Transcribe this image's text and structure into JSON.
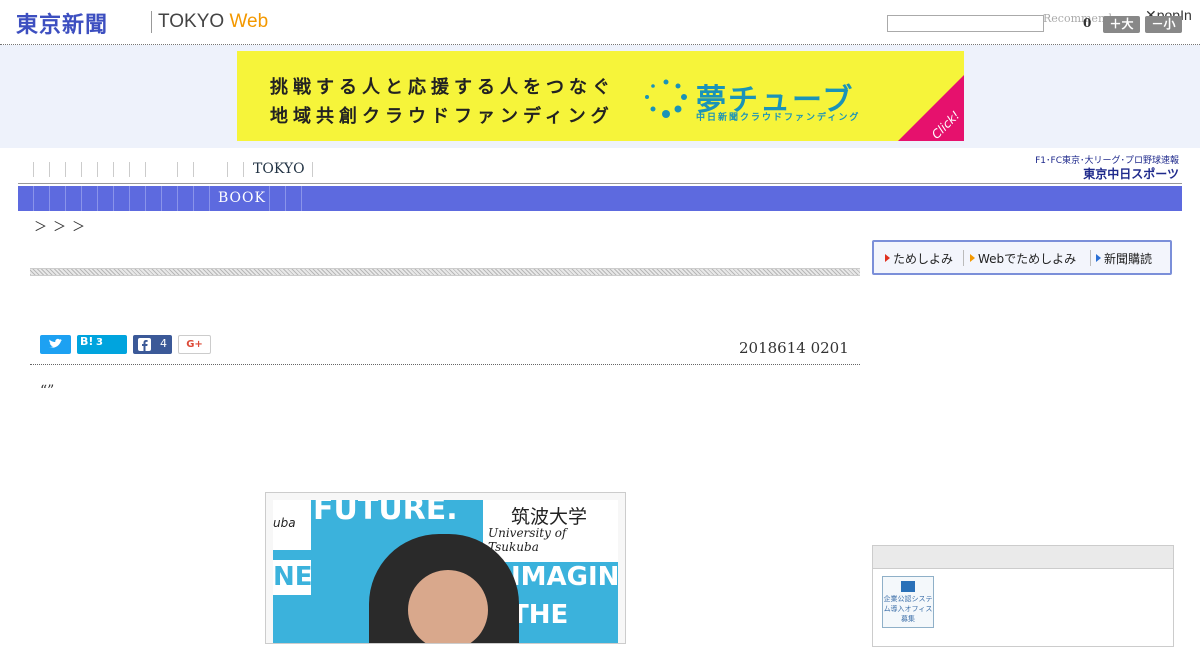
{
  "header": {
    "logo_jp": "東京新聞",
    "logo_en_main": "TOKYO",
    "logo_en_web": "Web",
    "search": {
      "value": "",
      "placeholder": ""
    },
    "recommend_text": "Recommend",
    "popin_label": "✕popIn",
    "count": "0",
    "font_larger": "＋大",
    "font_smaller": "－小"
  },
  "banner": {
    "line1": "挑戦する人と応援する人をつなぐ",
    "line2": "地域共創クラウドファンディング",
    "brand": "夢チューブ",
    "brand_sub": "中日新聞クラウドファンディング",
    "click": "Click!",
    "colors": {
      "background": "#f6f43a",
      "brand": "#1a93b8",
      "corner": "#e6116d"
    }
  },
  "nav": {
    "tokyo_label": "TOKYO",
    "sports_line1": "F1･FC東京･大リーグ･プロ野球速報",
    "sports_line2": "東京中日スポーツ",
    "category_label": "BOOK",
    "category_bar_color": "#5d6adf"
  },
  "breadcrumb": "＞＞＞",
  "sidebar": {
    "links": [
      {
        "label": "ためしよみ",
        "icon": "red-triangle-icon"
      },
      {
        "label": "Webでためしよみ",
        "icon": "orange-triangle-icon"
      },
      {
        "label": "新聞購読",
        "icon": "blue-triangle-icon"
      }
    ],
    "ad_thumb_text": "企業公認システム導入オフィス募集"
  },
  "article": {
    "share": {
      "twitter_icon": "twitter-icon",
      "hatena_label": "B!",
      "hatena_count": "3",
      "facebook_count": "4",
      "gplus_label": "G+"
    },
    "date": "2018614 0201",
    "quote": "“”",
    "photo": {
      "university_jp": "筑波大学",
      "university_en": "University of Tsukuba",
      "banner_words": [
        "FUTURE.",
        "IMAGINE",
        "THE",
        "uba",
        "NE"
      ]
    }
  }
}
